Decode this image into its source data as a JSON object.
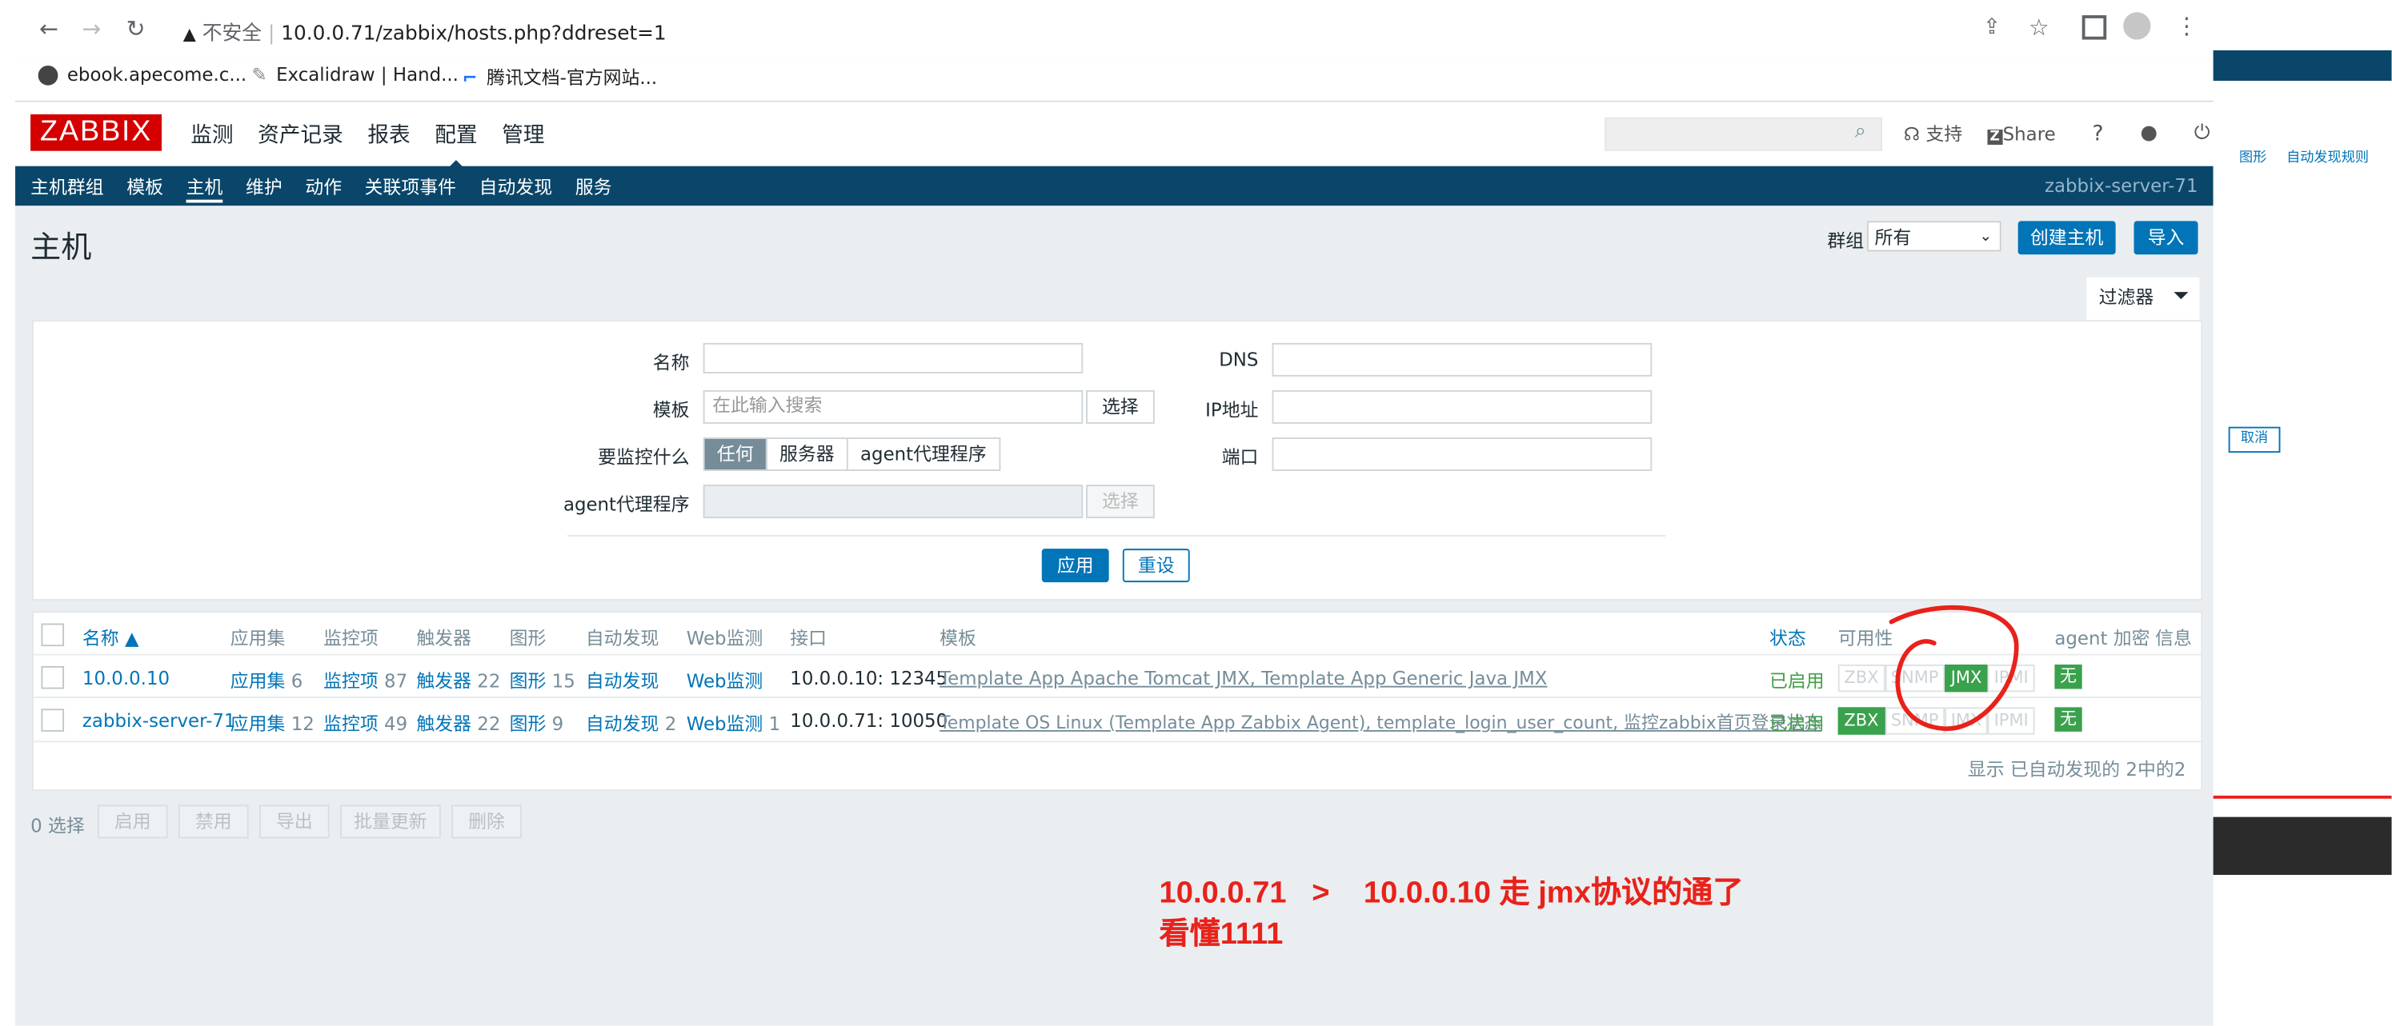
{
  "browser": {
    "security_label": "不安全",
    "url": "10.0.0.71/zabbix/hosts.php?ddreset=1",
    "bookmarks": [
      "ebook.apecome.c...",
      "Excalidraw | Hand...",
      "腾讯文档-官方网站..."
    ]
  },
  "header": {
    "logo": "ZABBIX",
    "menu": [
      "监测",
      "资产记录",
      "报表",
      "配置",
      "管理"
    ],
    "support": "支持",
    "share": "Share",
    "help": "?"
  },
  "subnav": {
    "items": [
      "主机群组",
      "模板",
      "主机",
      "维护",
      "动作",
      "关联项事件",
      "自动发现",
      "服务"
    ],
    "server": "zabbix-server-71"
  },
  "page": {
    "title": "主机",
    "group_label": "群组",
    "group_value": "所有",
    "create_button": "创建主机",
    "import_button": "导入",
    "filter_tab": "过滤器"
  },
  "filter": {
    "name_label": "名称",
    "template_label": "模板",
    "template_placeholder": "在此输入搜索",
    "select_button": "选择",
    "monitor_label": "要监控什么",
    "monitor_options": [
      "任何",
      "服务器",
      "agent代理程序"
    ],
    "proxy_label": "agent代理程序",
    "proxy_select": "选择",
    "dns_label": "DNS",
    "ip_label": "IP地址",
    "port_label": "端口",
    "apply": "应用",
    "reset": "重设"
  },
  "table": {
    "headers": [
      "名称 ▲",
      "应用集",
      "监控项",
      "触发器",
      "图形",
      "自动发现",
      "Web监测",
      "接口",
      "模板",
      "状态",
      "可用性",
      "agent 加密",
      "信息"
    ],
    "rows": [
      {
        "name": "10.0.0.10",
        "apps": "应用集",
        "apps_n": "6",
        "items": "监控项",
        "items_n": "87",
        "triggers": "触发器",
        "triggers_n": "22",
        "graphs": "图形",
        "graphs_n": "15",
        "discovery": "自动发现",
        "discovery_n": "",
        "web": "Web监测",
        "web_n": "",
        "interface": "10.0.0.10: 12345",
        "templates": "Template App Apache Tomcat JMX, Template App Generic Java JMX",
        "status": "已启用",
        "avail": [
          "ZBX",
          "SNMP",
          "JMX",
          "IPMI"
        ],
        "encrypt": "无"
      },
      {
        "name": "zabbix-server-71",
        "apps": "应用集",
        "apps_n": "12",
        "items": "监控项",
        "items_n": "49",
        "triggers": "触发器",
        "triggers_n": "22",
        "graphs": "图形",
        "graphs_n": "9",
        "discovery": "自动发现",
        "discovery_n": "2",
        "web": "Web监测",
        "web_n": "1",
        "interface": "10.0.0.71: 10050",
        "templates": "Template OS Linux (Template App Zabbix Agent), template_login_user_count, 监控zabbix首页登录状态",
        "status": "已启用",
        "avail": [
          "ZBX",
          "SNMP",
          "JMX",
          "IPMI"
        ],
        "encrypt": "无"
      }
    ],
    "summary": "显示 已自动发现的 2中的2"
  },
  "footer": {
    "selected": "0 选择",
    "buttons": [
      "启用",
      "禁用",
      "导出",
      "批量更新",
      "删除"
    ]
  },
  "annotation": {
    "line1": "10.0.0.71   >    10.0.0.10 走 jmx协议的通了",
    "line2": "看懂1111"
  },
  "right_panel": {
    "links": [
      "图形",
      "自动发现规则"
    ],
    "cancel": "取消"
  },
  "colors": {
    "brand_red": "#d40000",
    "nav_blue": "#0a466a",
    "button_blue": "#0275b8",
    "status_green": "#3aa14d",
    "annotation_red": "#e8221b"
  }
}
